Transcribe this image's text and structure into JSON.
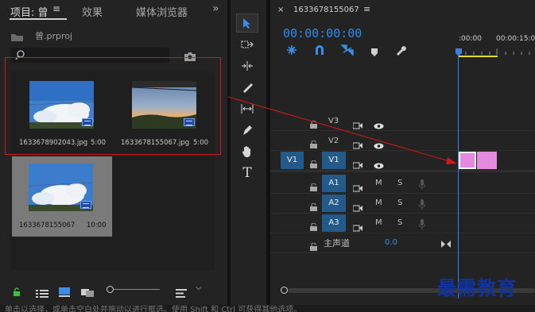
{
  "project": {
    "tabs": [
      {
        "label": "项目: 曾"
      },
      {
        "label": "效果"
      },
      {
        "label": "媒体浏览器"
      }
    ],
    "more_tabs_label": "»",
    "project_file": "曾.prproj",
    "search_placeholder": "",
    "items": [
      {
        "name": "1633678902043.jpg",
        "duration": "5:00"
      },
      {
        "name": "1633678155067.jpg",
        "duration": "5:00"
      },
      {
        "name": "1633678155067",
        "duration": "10:00"
      }
    ]
  },
  "timeline": {
    "sequence_name": "1633678155067",
    "timecode": "00:00:00:00",
    "ruler": [
      ":00:00",
      "00:00:15:0"
    ],
    "tracks": {
      "video": [
        {
          "label": "V3"
        },
        {
          "label": "V2"
        },
        {
          "label": "V1",
          "source": "V1"
        }
      ],
      "audio": [
        {
          "label": "A1",
          "m": "M",
          "s": "S"
        },
        {
          "label": "A2",
          "m": "M",
          "s": "S"
        },
        {
          "label": "A3",
          "m": "M",
          "s": "S"
        }
      ],
      "master": {
        "label": "主声道",
        "value": "0.0"
      }
    }
  },
  "status_bar": {
    "text": "单击以选择，或单击空白处并拖动以进行框选。使用 Shift 和 Ctrl 可获得其他选项。"
  },
  "watermark": {
    "text": "最需教育"
  },
  "colors": {
    "accent_blue": "#3a8ee6",
    "timecode_blue": "#2d8ceb",
    "annotation_red": "#d01818",
    "clip_pink": "#e58ae0",
    "playhead": "#3b7fe0"
  }
}
